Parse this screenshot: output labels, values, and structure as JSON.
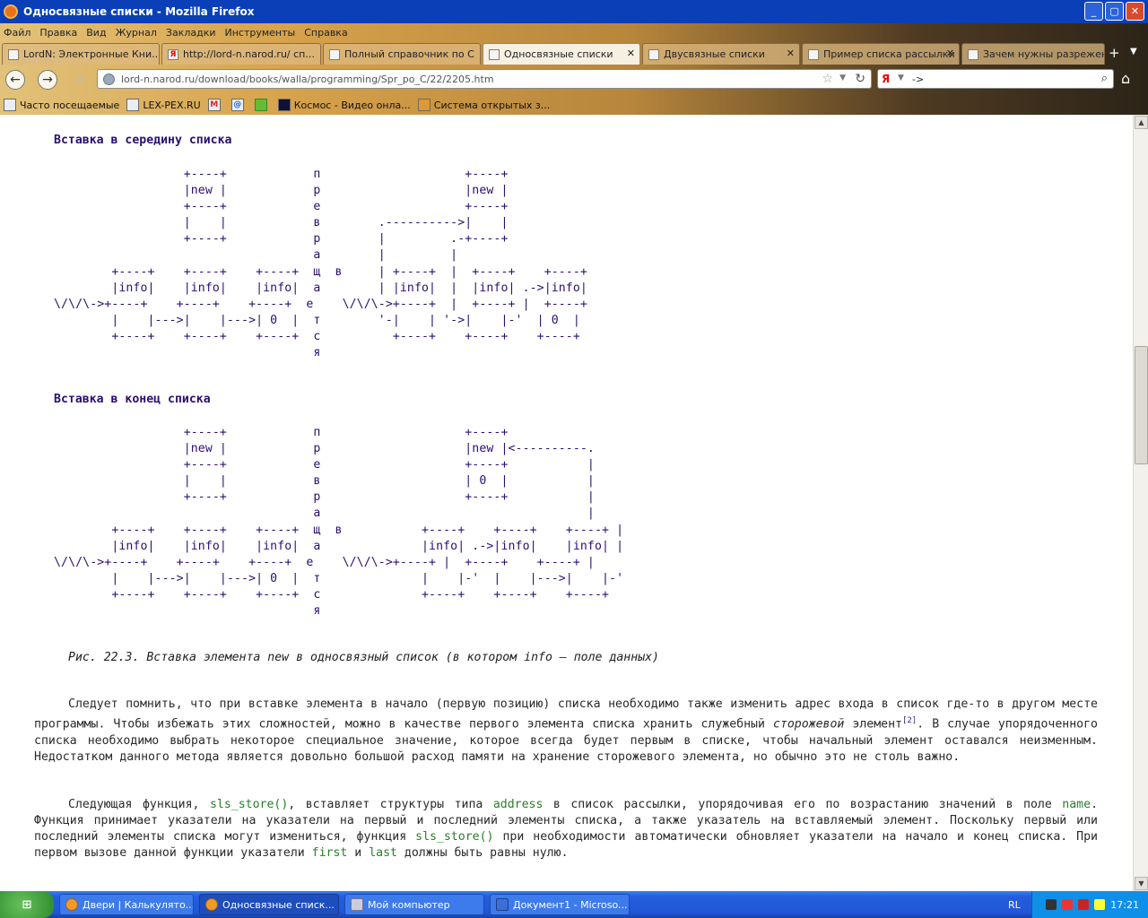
{
  "window": {
    "title": "Односвязные списки - Mozilla Firefox"
  },
  "menu": [
    "Файл",
    "Правка",
    "Вид",
    "Журнал",
    "Закладки",
    "Инструменты",
    "Справка"
  ],
  "tabs": [
    {
      "label": "LordN: Электронные Кни..."
    },
    {
      "label": "http://lord-n.narod.ru/ сп..."
    },
    {
      "label": "Полный справочник по С"
    },
    {
      "label": "Односвязные списки"
    },
    {
      "label": "Двусвязные списки"
    },
    {
      "label": "Пример списка рассылки"
    },
    {
      "label": "Зачем нужны разреженн..."
    }
  ],
  "url": "lord-n.narod.ru/download/books/walla/programming/Spr_po_C/22/2205.htm",
  "search": {
    "value": "->"
  },
  "bookmarks": [
    "Часто посещаемые",
    "LEX-PEX.RU",
    "",
    "",
    "",
    "Космос - Видео онла...",
    "Система открытых з..."
  ],
  "content": {
    "heading1": "Вставка в середину списка",
    "diagram1": "                  +----+            п                    +----+\n                  |new |            р                    |new |\n                  +----+            е                    +----+\n                  |    |            в        .---------->|    |\n                  +----+            р        |         .-+----+\n                                    а        |         |\n        +----+    +----+    +----+  щ  в     | +----+  |  +----+    +----+\n        |info|    |info|    |info|  а        | |info|  |  |info| .->|info|\n\\/\\/\\->+----+    +----+    +----+  е    \\/\\/\\->+----+  |  +----+ |  +----+\n        |    |--->|    |--->| 0  |  т        '-|    | '->|    |-'  | 0  |\n        +----+    +----+    +----+  с          +----+    +----+    +----+\n                                    я",
    "heading2": "Вставка в конец списка",
    "diagram2": "                  +----+            п                    +----+\n                  |new |            р                    |new |<----------.\n                  +----+            е                    +----+           |\n                  |    |            в                    | 0  |           |\n                  +----+            р                    +----+           |\n                                    а                                     |\n        +----+    +----+    +----+  щ  в           +----+    +----+    +----+ |\n        |info|    |info|    |info|  а              |info| .->|info|    |info| |\n\\/\\/\\->+----+    +----+    +----+  е    \\/\\/\\->+----+ |  +----+    +----+ |\n        |    |--->|    |--->| 0  |  т              |    |-'  |    |--->|    |-'\n        +----+    +----+    +----+  с              +----+    +----+    +----+\n                                    я",
    "caption": "Рис. 22.3. Вставка элемента new в односвязный список (в котором info — поле данных)",
    "p1": {
      "a": "Следует помнить, что при вставке элемента в начало (первую позицию) списка необходимо также изменить адрес входа в список где-то в другом месте программы. Чтобы избежать этих сложностей, можно в качестве первого элемента списка хранить служебный ",
      "em": "сторожевой",
      "b": " элемент",
      "sup": "[2]",
      "c": ". В случае упорядоченного списка необходимо выбрать некоторое специальное значение, которое всегда будет первым в списке, чтобы начальный элемент оставался неизменным. Недостатком данного метода является довольно большой расход памяти на хранение сторожевого элемента, но обычно это не столь важно."
    },
    "p2": {
      "a": "Следующая функция, ",
      "code1": "sls_store()",
      "b": ", вставляет структуры типа ",
      "code2": "address",
      "c": " в список рассылки, упорядочивая его по возрастанию значений в поле ",
      "code3": "name",
      "d": ". Функция принимает указатели на указатели на первый и последний элементы списка, а также указатель на вставляемый элемент. Поскольку первый или последний элементы списка могут измениться, функция ",
      "code4": "sls_store()",
      "e": " при необходимости автоматически обновляет указатели на начало и конец списка. При первом вызове данной функции указатели ",
      "code5": "first",
      "f": " и ",
      "code6": "last",
      "g": " должны быть равны нулю."
    }
  },
  "taskbar": {
    "start": "пуск",
    "tasks": [
      "Двери | Калькулято...",
      "Односвязные списк...",
      "Мой компьютер",
      "Документ1 - Microso..."
    ],
    "lang": "RL",
    "clock": "17:21"
  }
}
